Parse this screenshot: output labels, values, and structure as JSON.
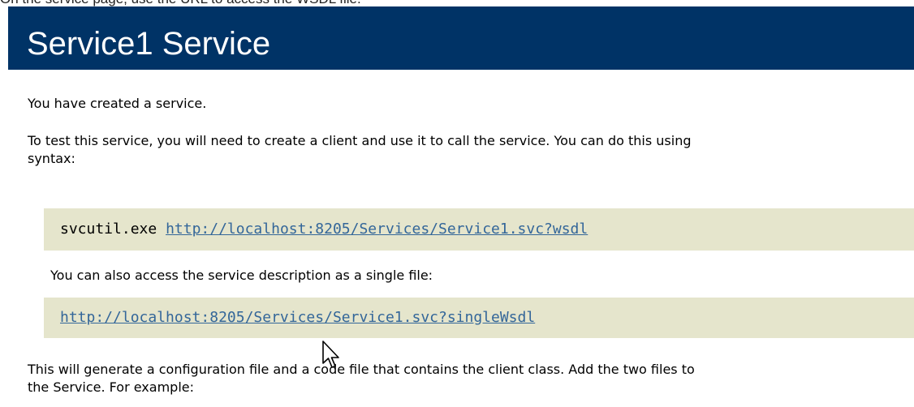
{
  "caption": "On the service page, use the URL to access the WSDL file.",
  "header": {
    "title": "Service1 Service"
  },
  "content": {
    "intro": "You have created a service.",
    "test_line1": "To test this service, you will need to create a client and use it to call the service. You can do this using",
    "test_line2": "syntax:",
    "svcutil_command": "svcutil.exe",
    "wsdl_url": "http://localhost:8205/Services/Service1.svc?wsdl",
    "single_file_text": "You can also access the service description as a single file:",
    "single_wsdl_url": "http://localhost:8205/Services/Service1.svc?singleWsdl",
    "generate_line1": "This will generate a configuration file and a code file that contains the client class. Add the two files to",
    "generate_line2": "the Service. For example:"
  },
  "colors": {
    "header_background": "#003366",
    "code_background": "#e5e5cc",
    "link": "#336699"
  },
  "icons": {
    "cursor": "mouse-pointer-icon"
  }
}
